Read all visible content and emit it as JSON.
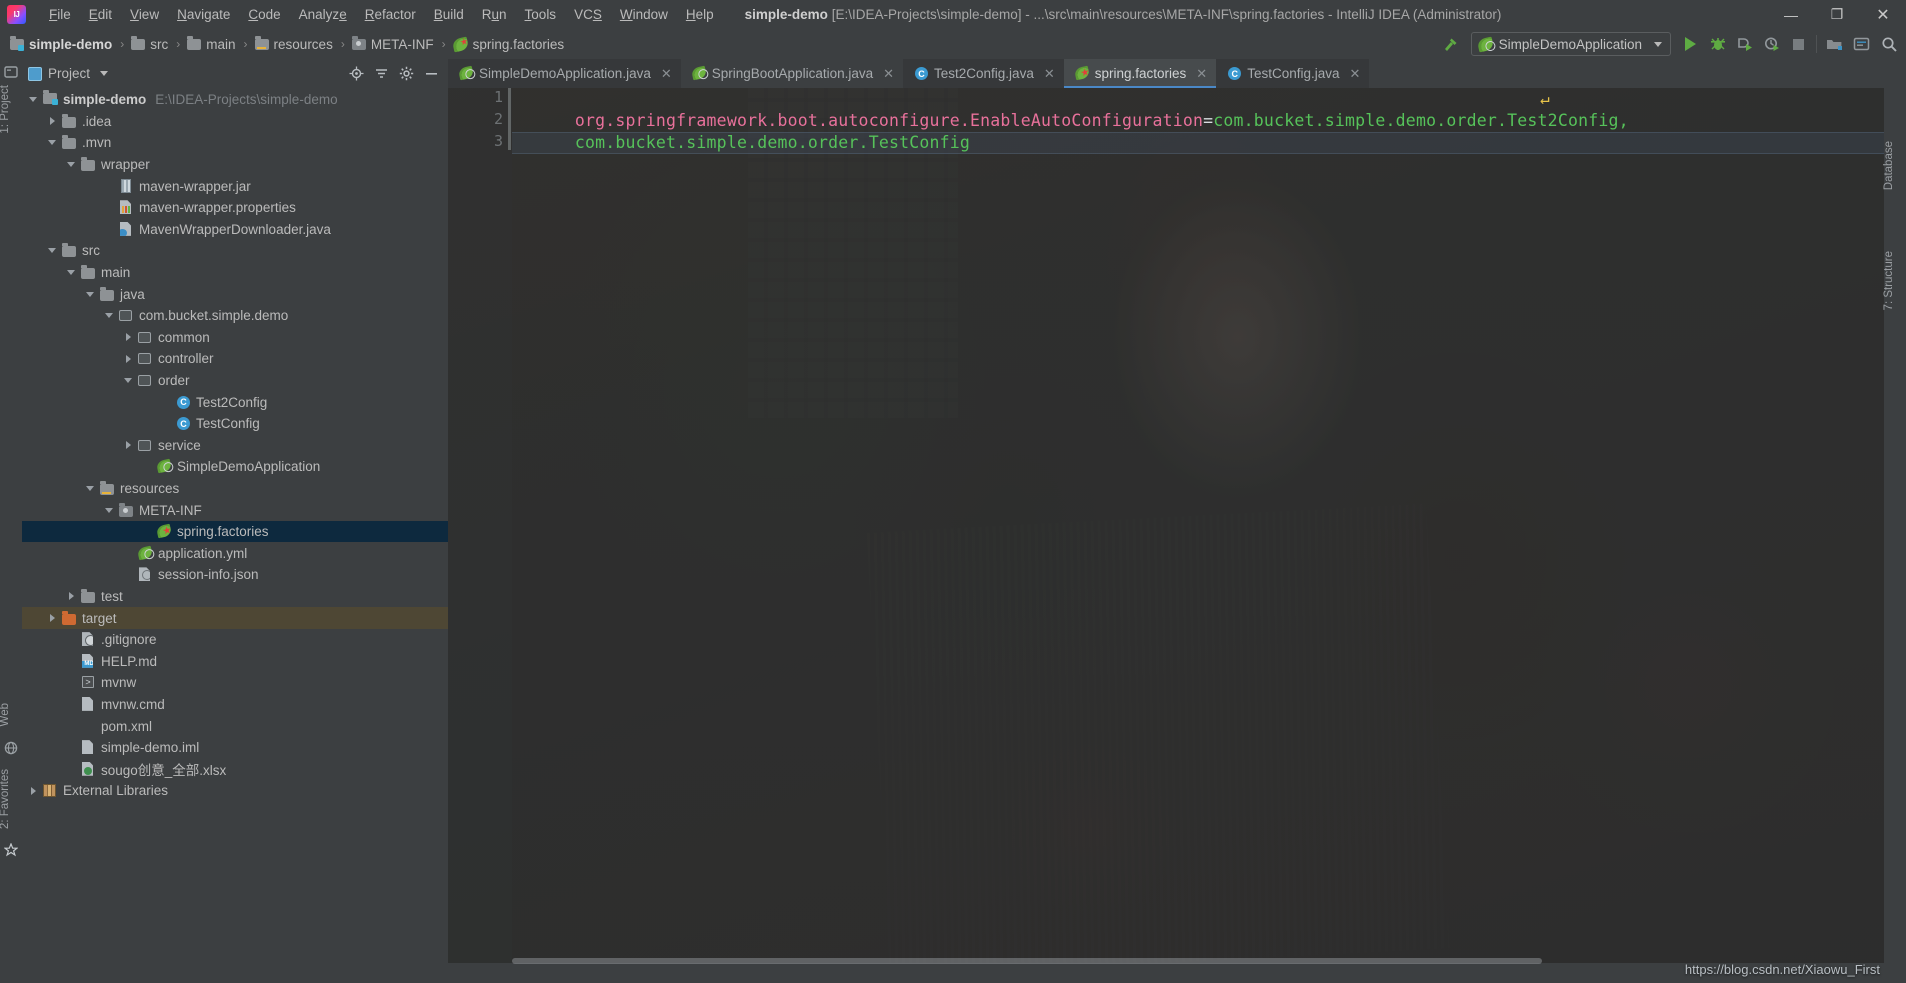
{
  "window": {
    "app_logo": "intellij-logo",
    "title_project": "simple-demo",
    "title_rest": "[E:\\IDEA-Projects\\simple-demo] - ...\\src\\main\\resources\\META-INF\\spring.factories - IntelliJ IDEA (Administrator)",
    "controls": {
      "minimize": "—",
      "maximize": "❐",
      "close": "✕"
    }
  },
  "menubar": {
    "items": [
      "File",
      "Edit",
      "View",
      "Navigate",
      "Code",
      "Analyze",
      "Refactor",
      "Build",
      "Run",
      "Tools",
      "VCS",
      "Window",
      "Help"
    ]
  },
  "breadcrumb": {
    "items": [
      {
        "label": "simple-demo",
        "icon": "module-folder-icon"
      },
      {
        "label": "src",
        "icon": "folder-icon"
      },
      {
        "label": "main",
        "icon": "folder-icon"
      },
      {
        "label": "resources",
        "icon": "resources-folder-icon"
      },
      {
        "label": "META-INF",
        "icon": "meta-inf-folder-icon"
      },
      {
        "label": "spring.factories",
        "icon": "spring-factories-icon"
      }
    ],
    "separator": "›"
  },
  "toolbar": {
    "build_icon": "hammer-icon",
    "run_config": "SimpleDemoApplication",
    "run_config_icon": "spring-boot-run-config-icon",
    "buttons": [
      {
        "name": "run-button",
        "icon": "play-icon"
      },
      {
        "name": "debug-button",
        "icon": "bug-icon"
      },
      {
        "name": "run-coverage-button",
        "icon": "coverage-icon"
      },
      {
        "name": "profiler-button",
        "icon": "profiler-icon"
      },
      {
        "name": "stop-button",
        "icon": "stop-icon"
      },
      {
        "name": "update-project-button",
        "icon": "vcs-update-icon"
      },
      {
        "name": "commit-button",
        "icon": "vcs-commit-icon"
      },
      {
        "name": "search-everywhere-button",
        "icon": "search-icon"
      }
    ]
  },
  "left_strips": [
    {
      "label": "1: Project",
      "name": "tool-window-project"
    },
    {
      "label": "Web",
      "name": "tool-window-web"
    },
    {
      "label": "2: Favorites",
      "name": "tool-window-favorites"
    }
  ],
  "right_strips": [
    {
      "label": "Database",
      "name": "tool-window-database"
    },
    {
      "label": "7: Structure",
      "name": "tool-window-structure"
    }
  ],
  "project_pane": {
    "title": "Project",
    "title_caret": "▾",
    "actions": [
      "locate-icon",
      "collapse-all-icon",
      "settings-icon",
      "hide-icon"
    ],
    "tree": [
      {
        "depth": 0,
        "arrow": "expanded",
        "icon": "module-folder-icon",
        "label": "simple-demo",
        "bold": true,
        "sub": "E:\\IDEA-Projects\\simple-demo",
        "state": "normal"
      },
      {
        "depth": 1,
        "arrow": "collapsed",
        "icon": "folder-icon",
        "label": ".idea",
        "state": "normal"
      },
      {
        "depth": 1,
        "arrow": "expanded",
        "icon": "folder-icon",
        "label": ".mvn",
        "state": "normal"
      },
      {
        "depth": 2,
        "arrow": "expanded",
        "icon": "folder-icon",
        "label": "wrapper",
        "state": "normal"
      },
      {
        "depth": 4,
        "arrow": "none",
        "icon": "jar-file-icon",
        "label": "maven-wrapper.jar",
        "state": "normal"
      },
      {
        "depth": 4,
        "arrow": "none",
        "icon": "properties-file-icon",
        "label": "maven-wrapper.properties",
        "state": "normal"
      },
      {
        "depth": 4,
        "arrow": "none",
        "icon": "java-file-icon",
        "label": "MavenWrapperDownloader.java",
        "state": "normal"
      },
      {
        "depth": 1,
        "arrow": "expanded",
        "icon": "folder-icon",
        "label": "src",
        "state": "normal"
      },
      {
        "depth": 2,
        "arrow": "expanded",
        "icon": "folder-icon",
        "label": "main",
        "state": "normal"
      },
      {
        "depth": 3,
        "arrow": "expanded",
        "icon": "source-folder-icon",
        "label": "java",
        "state": "normal"
      },
      {
        "depth": 4,
        "arrow": "expanded",
        "icon": "package-icon",
        "label": "com.bucket.simple.demo",
        "state": "normal"
      },
      {
        "depth": 5,
        "arrow": "collapsed",
        "icon": "package-icon",
        "label": "common",
        "state": "normal"
      },
      {
        "depth": 5,
        "arrow": "collapsed",
        "icon": "package-icon",
        "label": "controller",
        "state": "normal"
      },
      {
        "depth": 5,
        "arrow": "expanded",
        "icon": "package-icon",
        "label": "order",
        "state": "normal"
      },
      {
        "depth": 7,
        "arrow": "none",
        "icon": "java-class-icon",
        "label": "Test2Config",
        "state": "normal"
      },
      {
        "depth": 7,
        "arrow": "none",
        "icon": "java-class-icon",
        "label": "TestConfig",
        "state": "normal"
      },
      {
        "depth": 5,
        "arrow": "collapsed",
        "icon": "package-icon",
        "label": "service",
        "state": "normal"
      },
      {
        "depth": 6,
        "arrow": "none",
        "icon": "spring-boot-app-icon",
        "label": "SimpleDemoApplication",
        "state": "normal"
      },
      {
        "depth": 3,
        "arrow": "expanded",
        "icon": "resources-folder-icon",
        "label": "resources",
        "state": "normal"
      },
      {
        "depth": 4,
        "arrow": "expanded",
        "icon": "meta-inf-folder-icon",
        "label": "META-INF",
        "state": "normal"
      },
      {
        "depth": 6,
        "arrow": "none",
        "icon": "spring-factories-icon",
        "label": "spring.factories",
        "state": "selected"
      },
      {
        "depth": 5,
        "arrow": "none",
        "icon": "spring-yaml-icon",
        "label": "application.yml",
        "state": "normal"
      },
      {
        "depth": 5,
        "arrow": "none",
        "icon": "json-file-icon",
        "label": "session-info.json",
        "state": "normal"
      },
      {
        "depth": 2,
        "arrow": "collapsed",
        "icon": "folder-icon",
        "label": "test",
        "state": "normal"
      },
      {
        "depth": 1,
        "arrow": "collapsed",
        "icon": "excluded-folder-icon",
        "label": "target",
        "state": "highlighted"
      },
      {
        "depth": 2,
        "arrow": "none",
        "icon": "gitignore-file-icon",
        "label": ".gitignore",
        "state": "normal"
      },
      {
        "depth": 2,
        "arrow": "none",
        "icon": "markdown-file-icon",
        "label": "HELP.md",
        "state": "normal"
      },
      {
        "depth": 2,
        "arrow": "none",
        "icon": "shell-file-icon",
        "label": "mvnw",
        "state": "normal"
      },
      {
        "depth": 2,
        "arrow": "none",
        "icon": "cmd-file-icon",
        "label": "mvnw.cmd",
        "state": "normal"
      },
      {
        "depth": 2,
        "arrow": "none",
        "icon": "maven-xml-icon",
        "label": "pom.xml",
        "state": "normal"
      },
      {
        "depth": 2,
        "arrow": "none",
        "icon": "iml-file-icon",
        "label": "simple-demo.iml",
        "state": "normal"
      },
      {
        "depth": 2,
        "arrow": "none",
        "icon": "xlsx-file-icon",
        "label": "sougo创意_全部.xlsx",
        "state": "normal"
      },
      {
        "depth": 0,
        "arrow": "collapsed",
        "icon": "library-icon",
        "label": "External Libraries",
        "state": "normal"
      }
    ]
  },
  "editor_tabs": [
    {
      "label": "SimpleDemoApplication.java",
      "icon": "spring-boot-app-icon",
      "active": false,
      "close": "✕"
    },
    {
      "label": "SpringBootApplication.java",
      "icon": "spring-annotation-icon",
      "active": false,
      "close": "✕"
    },
    {
      "label": "Test2Config.java",
      "icon": "java-class-icon",
      "active": false,
      "close": "✕"
    },
    {
      "label": "spring.factories",
      "icon": "spring-factories-icon",
      "active": true,
      "close": "✕"
    },
    {
      "label": "TestConfig.java",
      "icon": "java-class-icon",
      "active": false,
      "close": "✕"
    }
  ],
  "editor": {
    "line_numbers": [
      "1",
      "2",
      "3"
    ],
    "lines": [
      {
        "num": "1",
        "key": "org.springframework.boot.autoconfigure.EnableAutoConfiguration",
        "eq": "=",
        "value": "com.bucket.simple.demo.order.Test2Config,",
        "wrap_marker": "↵"
      },
      {
        "num": "2",
        "key": "",
        "eq": "",
        "value": "com.bucket.simple.demo.order.TestConfig",
        "wrap_marker": ""
      },
      {
        "num": "3",
        "key": "",
        "eq": "",
        "value": "",
        "wrap_marker": ""
      }
    ]
  },
  "watermark": "https://blog.csdn.net/Xiaowu_First",
  "colors": {
    "background": "#3c3f41",
    "panel": "#3c3f41",
    "selection": "#0d293e",
    "accent": "#4a88c7",
    "key_pink": "#e8719b",
    "value_green": "#56c25a",
    "text": "#bbbbbb",
    "spring_green": "#6db33f",
    "target_highlight": "#4e4734"
  }
}
